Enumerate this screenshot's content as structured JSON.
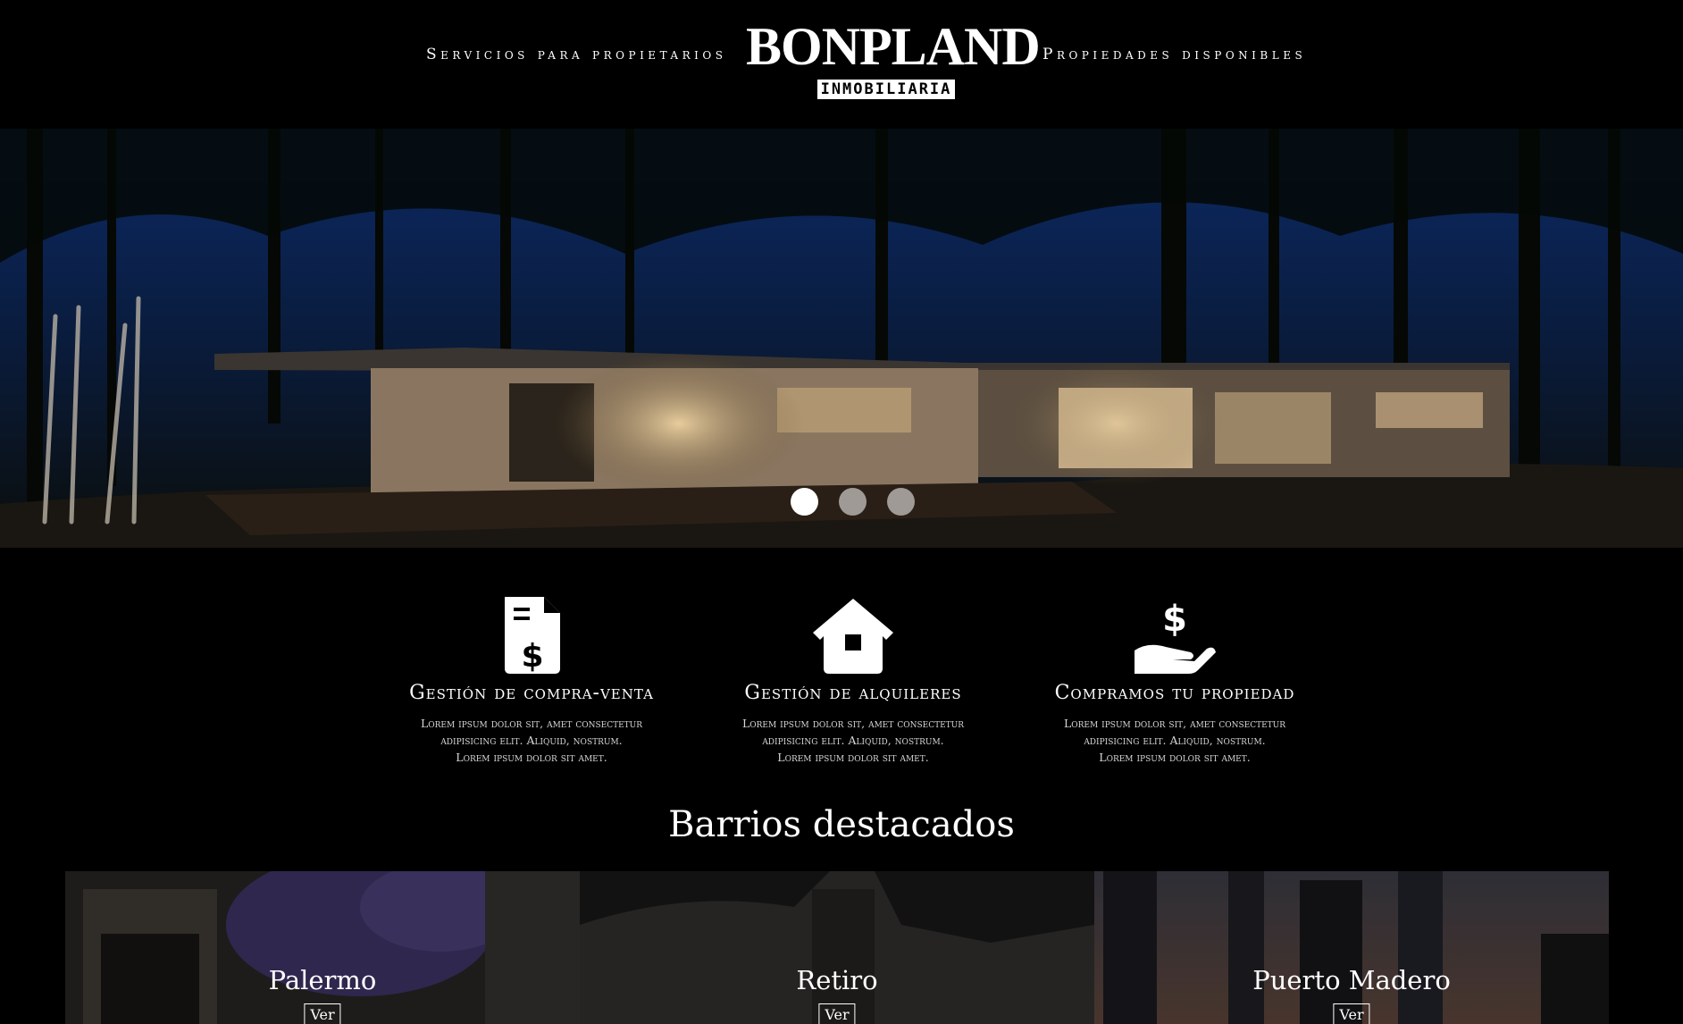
{
  "header": {
    "nav_left": "Servicios para propietarios",
    "nav_right": "Propiedades disponibles",
    "logo_title": "BONPLAND",
    "logo_subtitle": "INMOBILIARIA"
  },
  "hero": {
    "slide_count": 3,
    "active_slide": 1
  },
  "services": [
    {
      "icon": "invoice-dollar-icon",
      "title": "Gestión de compra-venta",
      "lines": [
        "Lorem ipsum dolor sit, amet consectetur",
        "adipisicing elit. Aliquid, nostrum.",
        "Lorem ipsum dolor sit amet."
      ]
    },
    {
      "icon": "house-icon",
      "title": "Gestión de alquileres",
      "lines": [
        "Lorem ipsum dolor sit, amet consectetur",
        "adipisicing elit. Aliquid, nostrum.",
        "Lorem ipsum dolor sit amet."
      ]
    },
    {
      "icon": "hand-dollar-icon",
      "title": "Compramos tu propiedad",
      "lines": [
        "Lorem ipsum dolor sit, amet consectetur",
        "adipisicing elit. Aliquid, nostrum.",
        "Lorem ipsum dolor sit amet."
      ]
    }
  ],
  "barrios": {
    "title": "Barrios destacados",
    "items": [
      {
        "name": "Palermo",
        "button": "Ver"
      },
      {
        "name": "Retiro",
        "button": "Ver"
      },
      {
        "name": "Puerto Madero",
        "button": "Ver"
      }
    ]
  },
  "colors": {
    "background": "#000000",
    "text": "#ffffff"
  }
}
